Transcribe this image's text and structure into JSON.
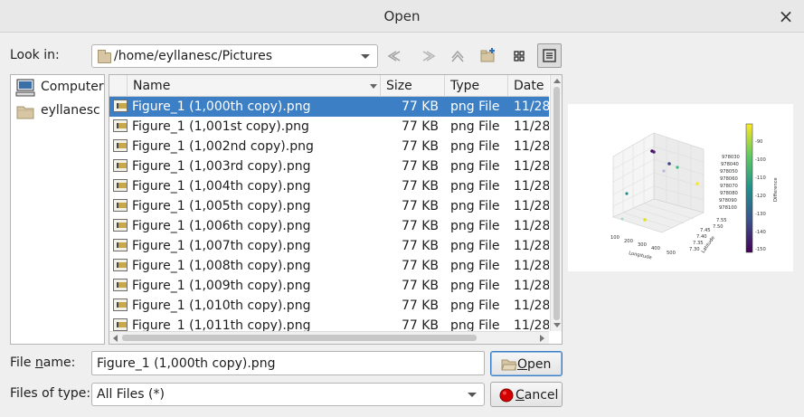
{
  "window": {
    "title": "Open"
  },
  "look_in": {
    "label": "Look in:",
    "path": "/home/eyllanesc/Pictures"
  },
  "toolbar": {
    "icons": [
      "back-icon",
      "forward-icon",
      "parent-dir-icon",
      "new-folder-icon",
      "icon-view-icon",
      "detail-view-icon"
    ],
    "active": "detail-view-icon"
  },
  "places": [
    {
      "label": "Computer",
      "icon": "computer-icon"
    },
    {
      "label": "eyllanesc",
      "icon": "folder-icon"
    }
  ],
  "columns": {
    "name": "Name",
    "size": "Size",
    "type": "Type",
    "date": "Date M"
  },
  "files": [
    {
      "name": "Figure_1 (1,000th copy).png",
      "size": "77 KB",
      "type": "png File",
      "date": "11/28",
      "selected": true
    },
    {
      "name": "Figure_1 (1,001st copy).png",
      "size": "77 KB",
      "type": "png File",
      "date": "11/28"
    },
    {
      "name": "Figure_1 (1,002nd copy).png",
      "size": "77 KB",
      "type": "png File",
      "date": "11/28"
    },
    {
      "name": "Figure_1 (1,003rd copy).png",
      "size": "77 KB",
      "type": "png File",
      "date": "11/28"
    },
    {
      "name": "Figure_1 (1,004th copy).png",
      "size": "77 KB",
      "type": "png File",
      "date": "11/28"
    },
    {
      "name": "Figure_1 (1,005th copy).png",
      "size": "77 KB",
      "type": "png File",
      "date": "11/28"
    },
    {
      "name": "Figure_1 (1,006th copy).png",
      "size": "77 KB",
      "type": "png File",
      "date": "11/28"
    },
    {
      "name": "Figure_1 (1,007th copy).png",
      "size": "77 KB",
      "type": "png File",
      "date": "11/28"
    },
    {
      "name": "Figure_1 (1,008th copy).png",
      "size": "77 KB",
      "type": "png File",
      "date": "11/28"
    },
    {
      "name": "Figure_1 (1,009th copy).png",
      "size": "77 KB",
      "type": "png File",
      "date": "11/28"
    },
    {
      "name": "Figure_1 (1,010th copy).png",
      "size": "77 KB",
      "type": "png File",
      "date": "11/28"
    },
    {
      "name": "Figure_1 (1,011th copy).png",
      "size": "77 KB",
      "type": "png File",
      "date": "11/28"
    }
  ],
  "preview": {
    "xlabel": "Longitude",
    "ylabel": "Latitude",
    "clabel": "Difference",
    "x_ticks": [
      "100",
      "200",
      "300",
      "400",
      "500"
    ],
    "y_ticks": [
      "7.30",
      "7.35",
      "7.40",
      "7.45",
      "7.50",
      "7.55"
    ],
    "z_ticks": [
      "978030",
      "978040",
      "978050",
      "978060",
      "978070",
      "978080",
      "978090",
      "978100"
    ],
    "c_ticks": [
      "-90",
      "-100",
      "-110",
      "-120",
      "-130",
      "-140",
      "-150"
    ]
  },
  "file_name": {
    "label": "File name:",
    "value": "Figure_1 (1,000th copy).png"
  },
  "files_of_type": {
    "label": "Files of type:",
    "value": "All Files (*)"
  },
  "buttons": {
    "open": "Open",
    "cancel": "Cancel"
  },
  "colors": {
    "selection": "#3d7fc4",
    "cancel_icon": "#d40000"
  }
}
